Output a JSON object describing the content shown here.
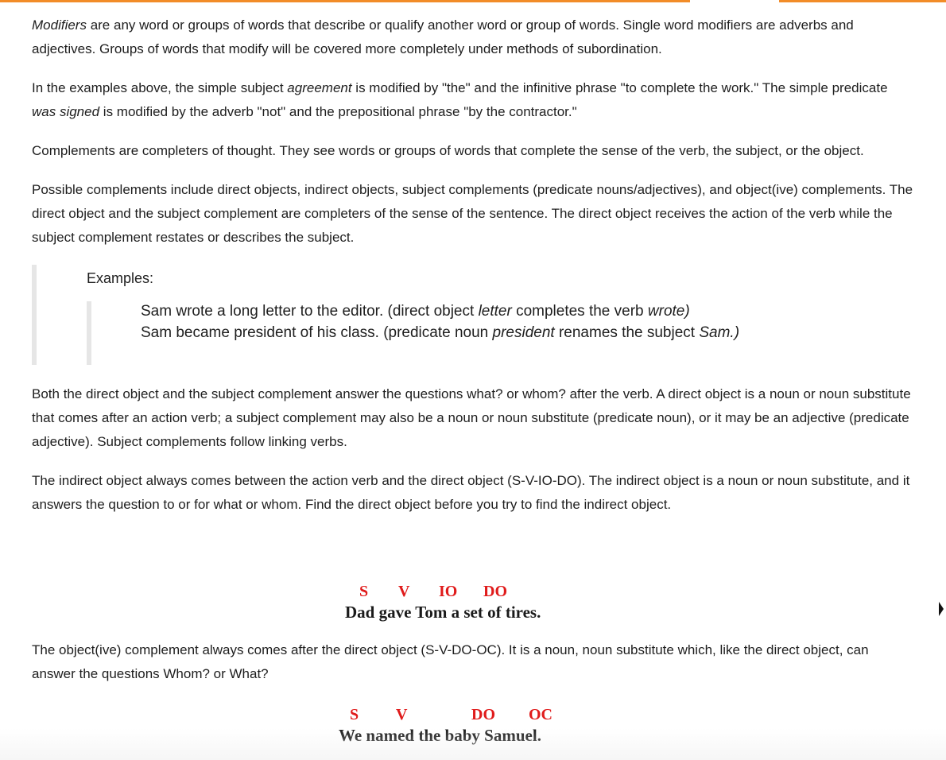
{
  "paragraphs": {
    "p1": {
      "term": "Modifiers",
      "rest": " are any word or groups of words that describe or qualify another word or group of words. Single word modifiers are adverbs and adjectives. Groups of words that modify will be covered more completely under methods of subordination."
    },
    "p2": {
      "a": "In the examples above, the simple subject ",
      "em1": "agreement",
      "b": " is modified by \"the\" and the infinitive phrase \"to complete the work.\" The simple predicate ",
      "em2": "was signed",
      "c": " is modified by the adverb \"not\" and the prepositional phrase \"by the contractor.\""
    },
    "p3": "Complements are completers of thought. They see words or groups of words that complete the sense of the verb, the subject, or the object.",
    "p4": "Possible complements include direct objects, indirect objects, subject complements (predicate nouns/adjectives), and object(ive) complements. The direct object and the subject complement are completers of the sense of the sentence. The direct object receives the action of the verb while the subject complement restates or describes the subject.",
    "p5": "Both the direct object and the subject complement answer the questions what? or whom? after the verb. A direct object is a noun or noun substitute that comes after an action verb; a subject complement may also be a noun or noun substitute (predicate noun), or it may be an adjective (predicate adjective). Subject complements follow linking verbs.",
    "p6": "The indirect object always comes between the action verb and the direct object (S-V-IO-DO). The indirect object is a noun or noun substitute, and it answers the question to or for what or whom. Find the direct object before you try to find the indirect object.",
    "p7": "The object(ive) complement always comes after the direct object (S-V-DO-OC). It is a noun, noun substitute which, like the direct object, can answer the questions Whom? or What?"
  },
  "examples": {
    "heading": "Examples:",
    "line1": {
      "a": "Sam wrote a long letter to the editor. (direct object ",
      "em1": "letter",
      "b": " completes the verb ",
      "em2": "wrote)"
    },
    "line2": {
      "a": "Sam became president of his class. (predicate noun ",
      "em1": "president",
      "b": " renames the subject ",
      "em2": "Sam.)"
    }
  },
  "diagram1": {
    "labels": [
      "S",
      "V",
      "IO",
      "DO"
    ],
    "sentence": "Dad gave Tom a set of tires."
  },
  "diagram2": {
    "labels": [
      "S",
      "V",
      "DO",
      "OC"
    ],
    "sentence": "We named the baby Samuel."
  },
  "colors": {
    "accent": "#f28c28",
    "label_red": "#e01b1b",
    "text": "#1e1e1e"
  }
}
